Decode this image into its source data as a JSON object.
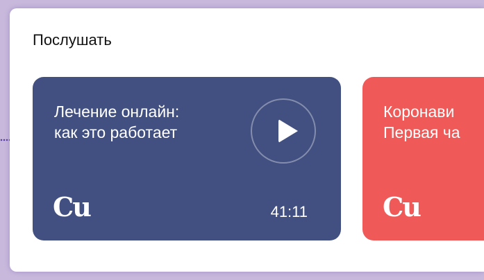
{
  "section": {
    "title": "Послушать"
  },
  "cards": [
    {
      "title": "Лечение онлайн:\nкак это работает",
      "logo": "Cu",
      "duration": "41:11",
      "background": "#425081"
    },
    {
      "title": "Коронави\nПервая ча",
      "logo": "Cu",
      "background": "#ef5a58"
    }
  ],
  "icons": {
    "play": "play-icon"
  }
}
